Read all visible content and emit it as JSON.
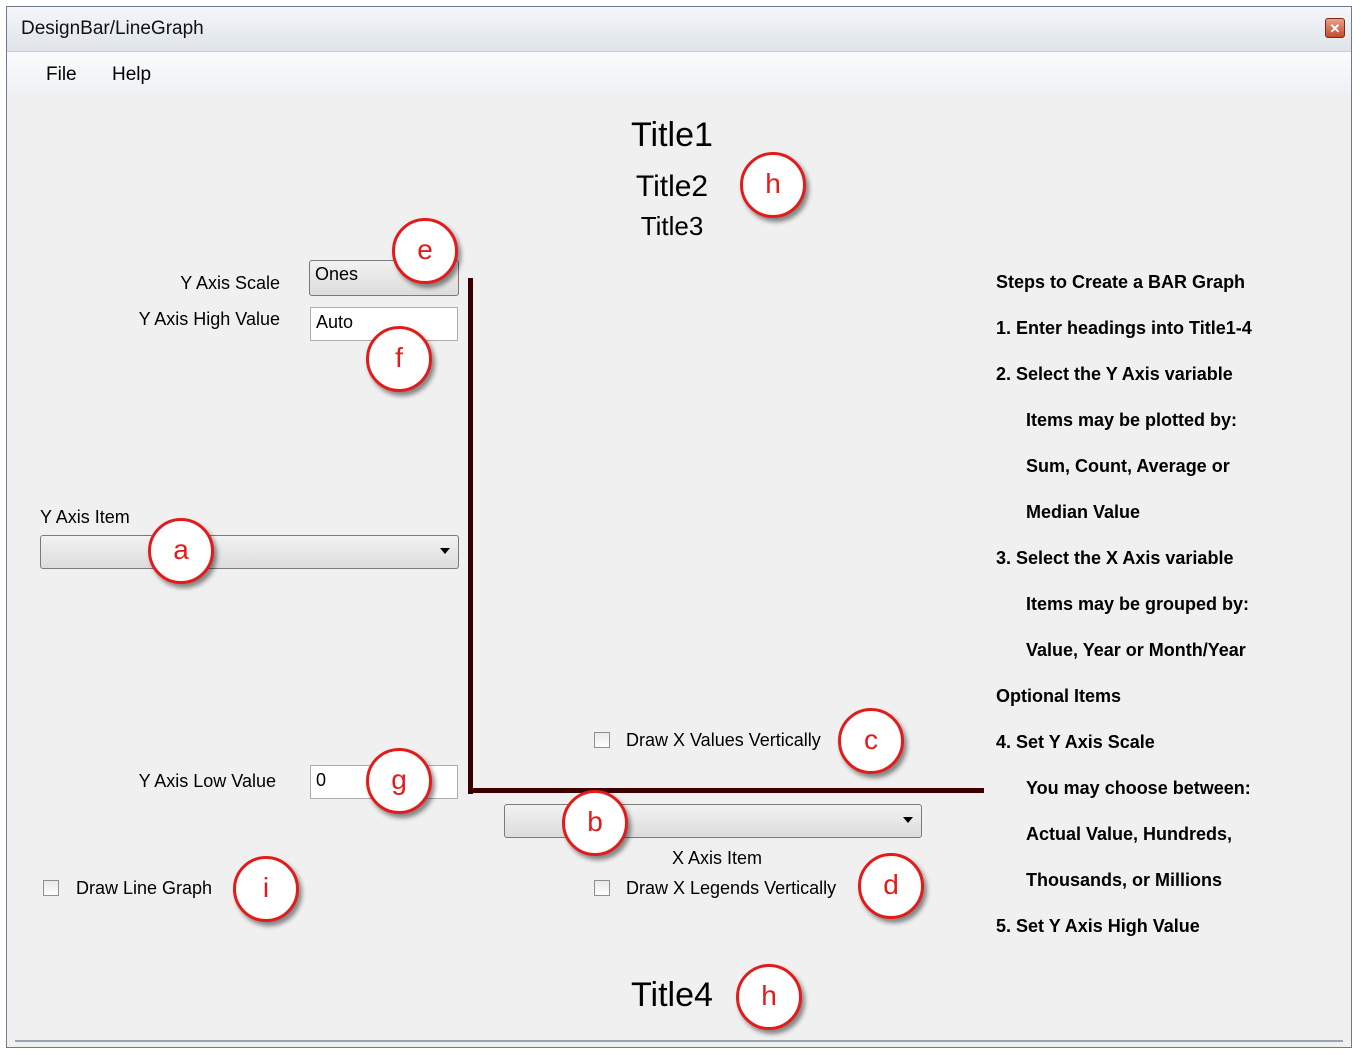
{
  "window": {
    "title": "DesignBar/LineGraph",
    "close_icon": "close-icon"
  },
  "menu": {
    "file": "File",
    "help": "Help"
  },
  "titles": {
    "title1": "Title1",
    "title2": "Title2",
    "title3": "Title3",
    "title4": "Title4"
  },
  "y_axis_scale": {
    "label": "Y Axis Scale",
    "value": "Ones"
  },
  "y_axis_high": {
    "label": "Y Axis High Value",
    "value": "Auto"
  },
  "y_axis_item": {
    "label": "Y Axis Item",
    "value": ""
  },
  "y_axis_low": {
    "label": "Y Axis Low Value",
    "value": "0"
  },
  "x_axis_item": {
    "label": "X Axis Item",
    "value": ""
  },
  "checkboxes": {
    "draw_x_values_vertically": "Draw X Values Vertically",
    "draw_x_legends_vertically": "Draw X Legends Vertically",
    "draw_line_graph": "Draw Line Graph"
  },
  "steps": [
    "Steps to Create a BAR Graph",
    "1.  Enter headings into Title1-4",
    "2.  Select the Y Axis variable",
    "Items may be plotted by:",
    "Sum, Count, Average or",
    "Median Value",
    "3.  Select the X Axis variable",
    "Items may be grouped by:",
    "Value, Year or Month/Year",
    "Optional Items",
    "4.  Set Y Axis Scale",
    "You may choose between:",
    "Actual Value, Hundreds,",
    "Thousands, or Millions",
    "5.  Set Y Axis High Value"
  ],
  "callouts": {
    "a": "a",
    "b": "b",
    "c": "c",
    "d": "d",
    "e": "e",
    "f": "f",
    "g": "g",
    "h": "h",
    "i": "i"
  },
  "colors": {
    "axis": "#3a0000",
    "callout": "#e41b1b"
  }
}
